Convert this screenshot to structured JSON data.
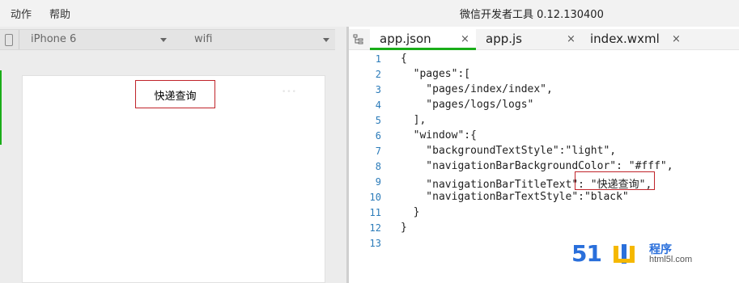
{
  "menubar": {
    "items": [
      "动作",
      "帮助"
    ],
    "title": "微信开发者工具 0.12.130400"
  },
  "simulator": {
    "device": "iPhone 6",
    "network": "wifi",
    "navigation_title": "快递查询",
    "capsule": "•••"
  },
  "editor": {
    "tabs": [
      {
        "label": "app.json",
        "close": "×"
      },
      {
        "label": "app.js",
        "close": "×"
      },
      {
        "label": "index.wxml",
        "close": "×"
      }
    ],
    "code_lines": [
      {
        "n": "1",
        "text": "{"
      },
      {
        "n": "2",
        "text": "  \"pages\":["
      },
      {
        "n": "3",
        "text": "    \"pages/index/index\","
      },
      {
        "n": "4",
        "text": "    \"pages/logs/logs\""
      },
      {
        "n": "5",
        "text": "  ],"
      },
      {
        "n": "6",
        "text": "  \"window\":{"
      },
      {
        "n": "7",
        "text": "    \"backgroundTextStyle\":\"light\","
      },
      {
        "n": "8",
        "text": "    \"navigationBarBackgroundColor\": \"#fff\","
      },
      {
        "n": "9",
        "text": "    \"navigationBarTitleText\": \"快递查询\","
      },
      {
        "n": "10",
        "text": "    \"navigationBarTextStyle\":\"black\""
      },
      {
        "n": "11",
        "text": "  }"
      },
      {
        "n": "12",
        "text": "}"
      },
      {
        "n": "13",
        "text": ""
      }
    ]
  },
  "watermark": {
    "brand": "51",
    "cheng": "程序",
    "url": "html5l.com"
  },
  "colors": {
    "accent_green": "#1aad19",
    "highlight_red": "#c0242a",
    "line_number_blue": "#2b7bb9",
    "logo_blue": "#2a6fdb",
    "logo_yellow": "#f5b800"
  }
}
